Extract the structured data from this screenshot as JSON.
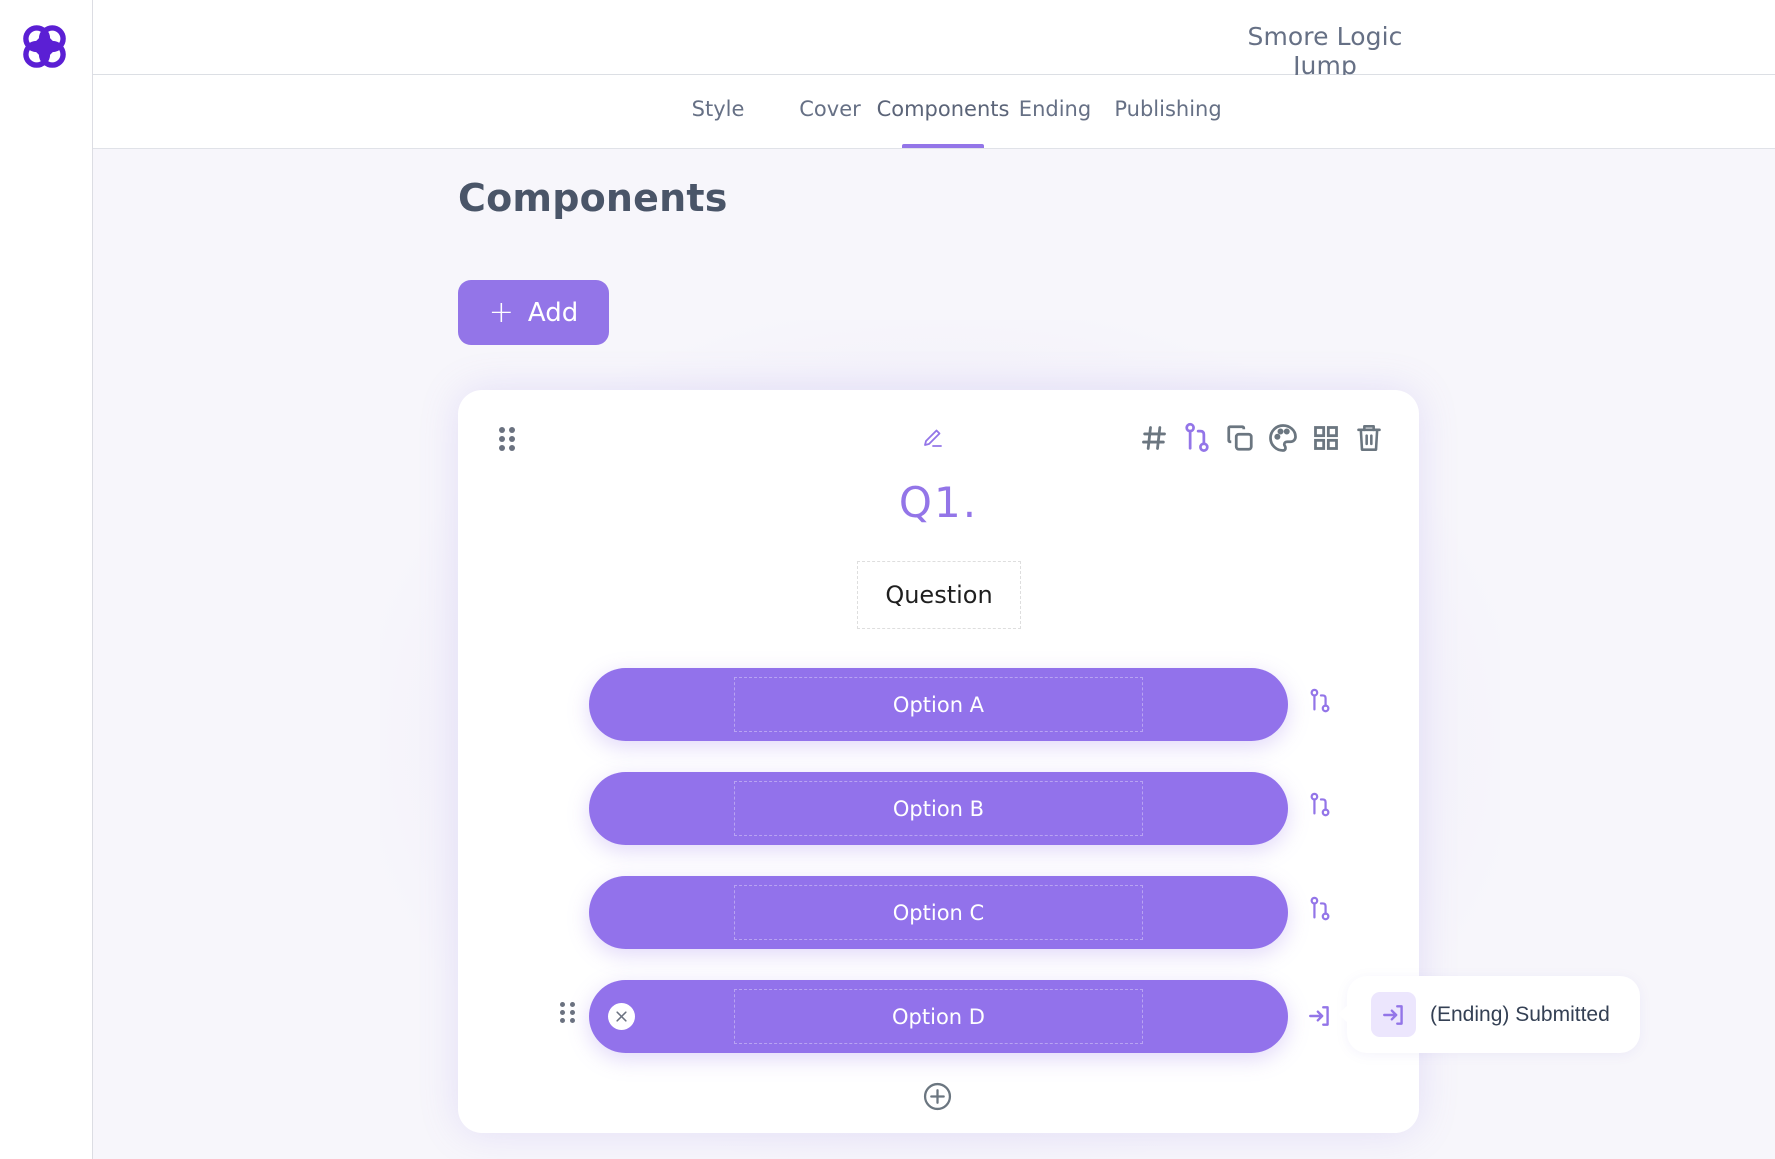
{
  "app": {
    "title": "Smore Logic Jump",
    "accent_color": "#9375e8",
    "logo_color": "#5b1fd4"
  },
  "tabs": [
    {
      "label": "Style",
      "active": false
    },
    {
      "label": "Cover",
      "active": false
    },
    {
      "label": "Components",
      "active": true
    },
    {
      "label": "Ending",
      "active": false
    },
    {
      "label": "Publishing",
      "active": false
    }
  ],
  "page": {
    "heading": "Components",
    "add_button_label": "Add",
    "add_button_icon": "plus-icon"
  },
  "card": {
    "question_number": "Q1.",
    "question_text": "Question",
    "toolbar": [
      {
        "name": "number-icon",
        "glyph": "#"
      },
      {
        "name": "logic-jump-icon"
      },
      {
        "name": "duplicate-icon"
      },
      {
        "name": "palette-icon"
      },
      {
        "name": "layout-grid-icon"
      },
      {
        "name": "trash-icon"
      }
    ],
    "options": [
      {
        "label": "Option A",
        "logic_icon": "logic-jump-icon"
      },
      {
        "label": "Option B",
        "logic_icon": "logic-jump-icon"
      },
      {
        "label": "Option C",
        "logic_icon": "logic-jump-icon"
      },
      {
        "label": "Option D",
        "logic_icon": "jump-to-ending-icon",
        "hovered": true
      }
    ]
  },
  "tooltip": {
    "text": "(Ending) Submitted",
    "icon": "jump-to-ending-icon"
  }
}
